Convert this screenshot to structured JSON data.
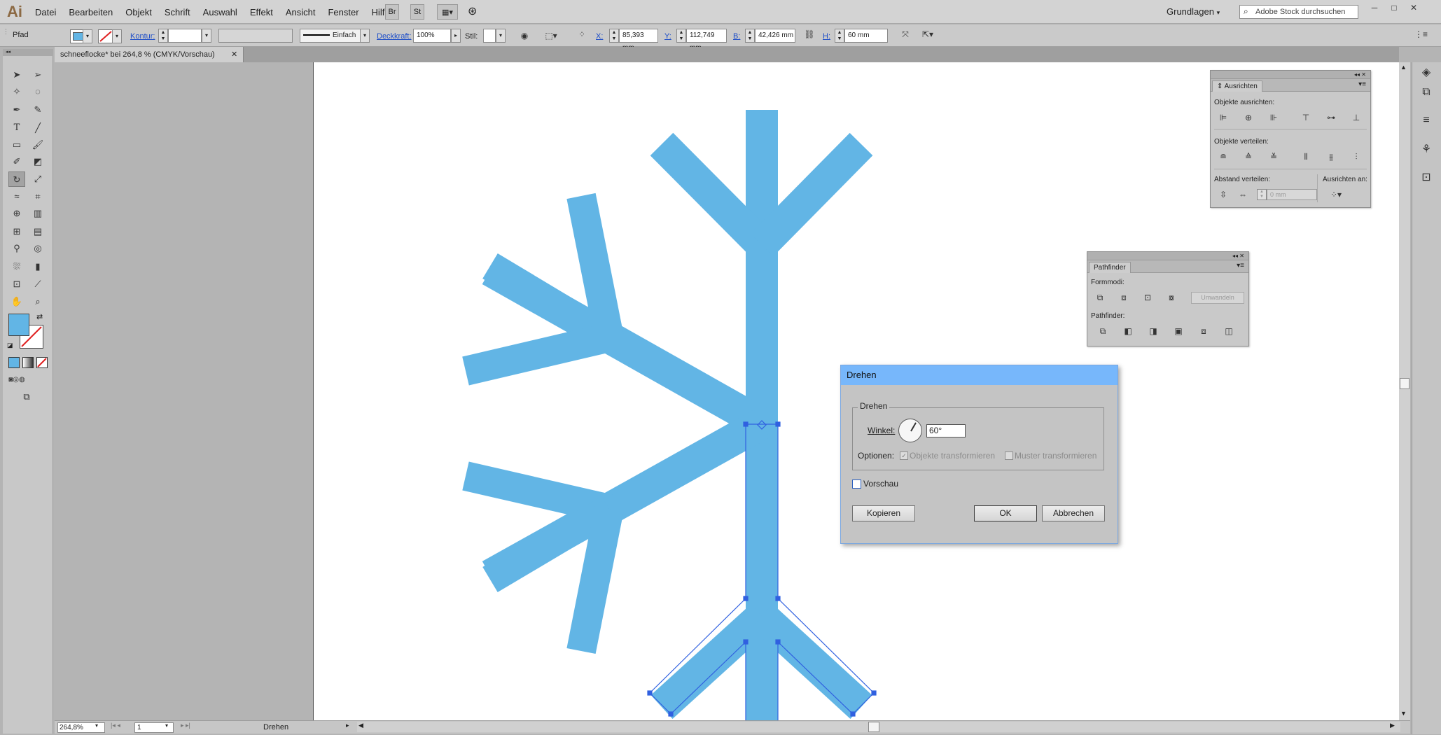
{
  "app": {
    "logo": "Ai",
    "menus": [
      "Datei",
      "Bearbeiten",
      "Objekt",
      "Schrift",
      "Auswahl",
      "Effekt",
      "Ansicht",
      "Fenster",
      "Hilfe"
    ],
    "bridge_label": "Br",
    "stock_label": "St",
    "workspace": "Grundlagen",
    "workspace_arrow": "▾",
    "search_placeholder": "Adobe Stock durchsuchen",
    "window_controls": [
      "─",
      "□",
      "✕"
    ]
  },
  "control_bar": {
    "selection_type": "Pfad",
    "fill_color": "#62b5e5",
    "kontur_label": "Kontur:",
    "stroke_style": "Einfach",
    "deckkraft_label": "Deckkraft:",
    "deckkraft_value": "100%",
    "stil_label": "Stil:",
    "x_label": "X:",
    "x_value": "85,393 mm",
    "y_label": "Y:",
    "y_value": "112,749 mm",
    "b_label": "B:",
    "b_value": "42,426 mm",
    "h_label": "H:",
    "h_value": "60 mm"
  },
  "document": {
    "tab_title": "schneeflocke* bei 264,8 % (CMYK/Vorschau)",
    "tab_close": "✕",
    "zoom": "264,8%",
    "artboard_number": "1",
    "status_text": "Drehen"
  },
  "artwork": {
    "shape_color": "#62b5e5",
    "selection_color": "#3060e0"
  },
  "panels": {
    "ausrichten": {
      "title": "Ausrichten",
      "objekte_ausrichten": "Objekte ausrichten:",
      "objekte_verteilen": "Objekte verteilen:",
      "abstand_verteilen": "Abstand verteilen:",
      "ausrichten_an": "Ausrichten an:",
      "spacing_value": "0 mm"
    },
    "pathfinder": {
      "title": "Pathfinder",
      "formmodi": "Formmodi:",
      "umwandeln": "Umwandeln",
      "pathfinder_label": "Pathfinder:"
    }
  },
  "dialog": {
    "title": "Drehen",
    "group_label": "Drehen",
    "winkel_label": "Winkel:",
    "winkel_value": "60°",
    "optionen_label": "Optionen:",
    "option_objekte": "Objekte transformieren",
    "option_muster": "Muster transformieren",
    "vorschau_label": "Vorschau",
    "kopieren_label": "Kopieren",
    "ok_label": "OK",
    "abbrechen_label": "Abbrechen"
  }
}
